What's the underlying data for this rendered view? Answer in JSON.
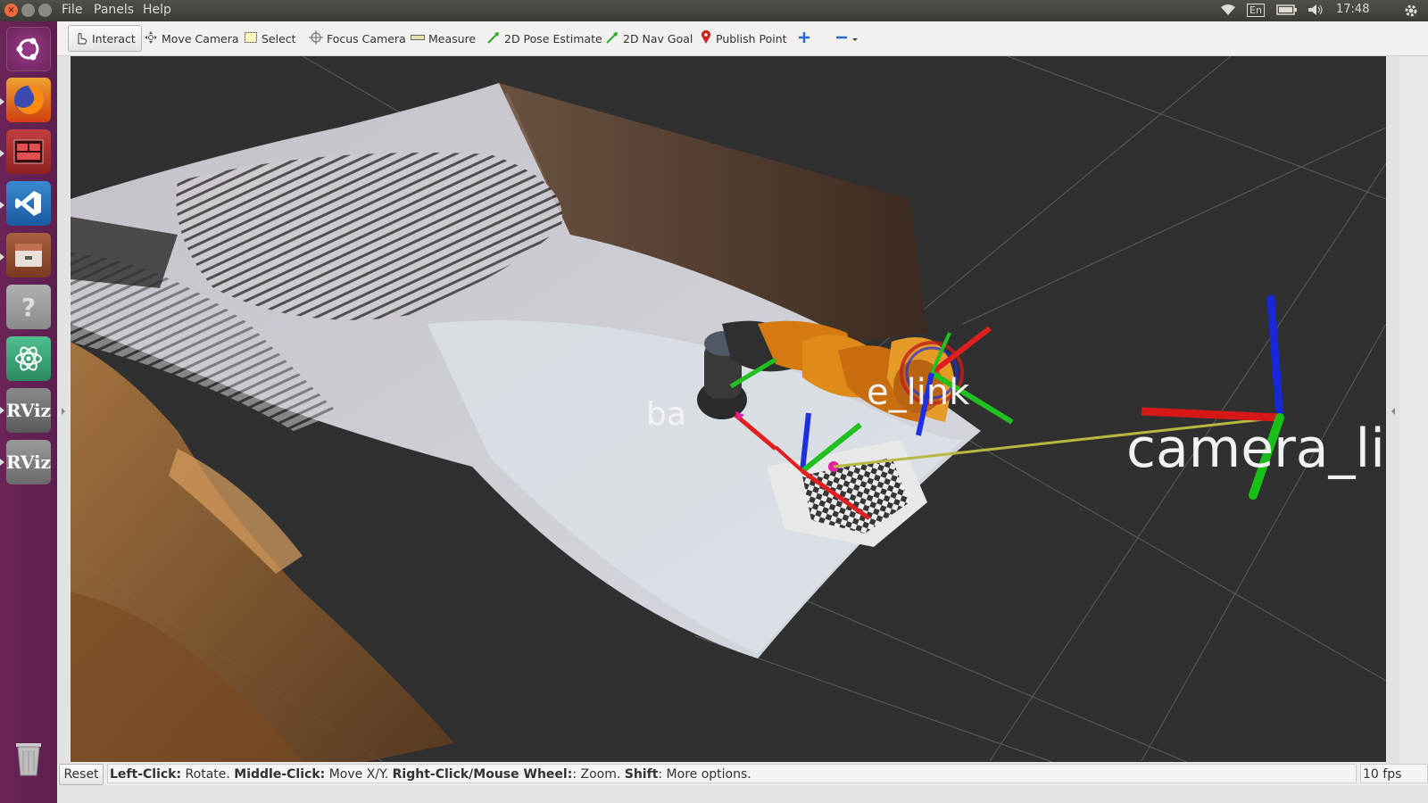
{
  "topbar": {
    "menus": [
      "File",
      "Panels",
      "Help"
    ],
    "keyboard_layout": "En",
    "clock": "17:48"
  },
  "launcher": {
    "apps": [
      {
        "name": "ubuntu-dash-icon",
        "color": "#7a2a6a"
      },
      {
        "name": "firefox-icon",
        "color": "#e66000"
      },
      {
        "name": "terminal-icon",
        "color": "#b23030"
      },
      {
        "name": "vscode-icon",
        "color": "#2266aa"
      },
      {
        "name": "files-icon",
        "color": "#8a5030"
      },
      {
        "name": "help-icon",
        "color": "#8a8a8a"
      },
      {
        "name": "atom-icon",
        "color": "#3aa078"
      },
      {
        "name": "rviz-icon-1",
        "label": "RViz"
      },
      {
        "name": "rviz-icon-2",
        "label": "RViz"
      },
      {
        "name": "trash-icon",
        "color": "#b0b0b0"
      }
    ]
  },
  "toolbar": {
    "interact": "Interact",
    "move_camera": "Move Camera",
    "select": "Select",
    "focus_camera": "Focus Camera",
    "measure": "Measure",
    "pose_estimate": "2D Pose Estimate",
    "nav_goal": "2D Nav Goal",
    "publish_point": "Publish Point"
  },
  "viewport": {
    "labels": {
      "base": "ba",
      "ee_link": "e_link",
      "camera_link": "camera_li"
    },
    "axis_colors": {
      "x": "#e02020",
      "y": "#20c020",
      "z": "#2030e0"
    },
    "background": "#303030",
    "robot_color": "#e08a1a"
  },
  "statusbar": {
    "reset": "Reset",
    "help": {
      "k1": "Left-Click:",
      "v1": " Rotate. ",
      "k2": "Middle-Click:",
      "v2": " Move X/Y. ",
      "k3": "Right-Click/Mouse Wheel:",
      "v3": ": Zoom. ",
      "k4": "Shift",
      "v4": ": More options."
    },
    "fps": "10 fps"
  }
}
